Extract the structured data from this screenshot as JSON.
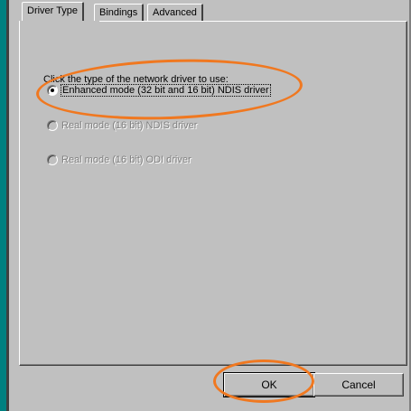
{
  "tabs": [
    {
      "label": "Driver Type",
      "active": true
    },
    {
      "label": "Bindings",
      "active": false
    },
    {
      "label": "Advanced",
      "active": false
    }
  ],
  "prompt": "Click the type of the network driver to use:",
  "options": [
    {
      "label": "Enhanced mode (32 bit and 16 bit) NDIS driver",
      "checked": true,
      "enabled": true
    },
    {
      "label": "Real mode (16 bit) NDIS driver",
      "checked": false,
      "enabled": false
    },
    {
      "label": "Real mode (16 bit) ODI driver",
      "checked": false,
      "enabled": false
    }
  ],
  "buttons": {
    "ok": "OK",
    "cancel": "Cancel"
  },
  "colors": {
    "dialog_face": "#c0c0c0",
    "desktop_teal": "#008080",
    "annotation": "#f07820"
  }
}
